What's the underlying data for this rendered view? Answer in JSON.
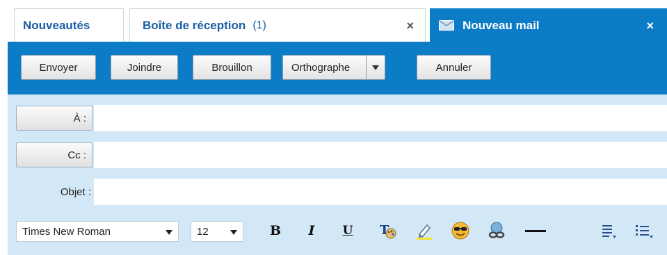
{
  "tabs": [
    {
      "label": "Nouveautés"
    },
    {
      "label": "Boîte de réception",
      "count": "(1)",
      "close": "×"
    },
    {
      "label": "Nouveau mail",
      "close": "×",
      "icon": "envelope-icon"
    }
  ],
  "toolbar": {
    "send_label": "Envoyer",
    "attach_label": "Joindre",
    "draft_label": "Brouillon",
    "spellcheck_label": "Orthographe",
    "cancel_label": "Annuler"
  },
  "form": {
    "to_label": "À :",
    "to_value": "",
    "cc_label": "Cc :",
    "cc_value": "",
    "subject_label": "Objet :",
    "subject_value": ""
  },
  "format": {
    "font_family": "Times New Roman",
    "font_size": "12",
    "bold": "B",
    "italic": "I",
    "underline": "U",
    "icons": [
      "text-color-icon",
      "highlight-icon",
      "smiley-icon",
      "link-icon",
      "horizontal-rule-icon",
      "align-icon",
      "list-icon"
    ]
  },
  "colors": {
    "accent": "#0d7cc6",
    "tab_text": "#1a5fa3",
    "form_background": "#d2e8f7"
  }
}
